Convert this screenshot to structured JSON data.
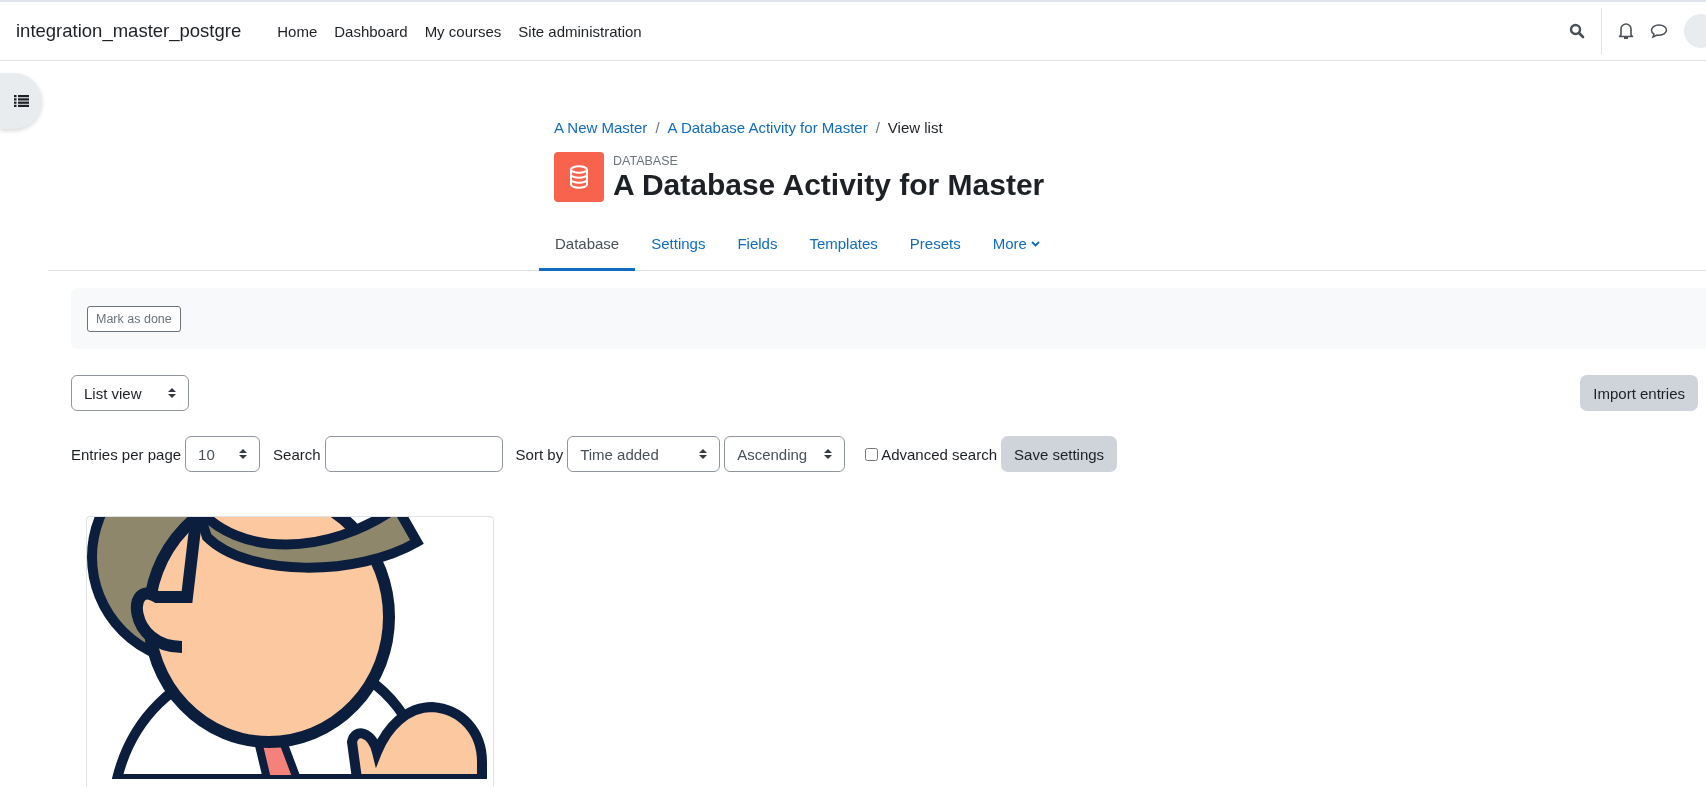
{
  "navbar": {
    "site_name": "integration_master_postgre",
    "menu": [
      {
        "label": "Home"
      },
      {
        "label": "Dashboard"
      },
      {
        "label": "My courses"
      },
      {
        "label": "Site administration"
      }
    ]
  },
  "breadcrumb_separator": "/",
  "breadcrumb": [
    {
      "label": "A New Master",
      "link": true
    },
    {
      "label": "A Database Activity for Master",
      "link": true
    },
    {
      "label": "View list",
      "link": false
    }
  ],
  "header": {
    "module": "DATABASE",
    "title": "A Database Activity for Master"
  },
  "tabs": [
    {
      "label": "Database",
      "selected": true,
      "dropdown": false
    },
    {
      "label": "Settings",
      "selected": false,
      "dropdown": false
    },
    {
      "label": "Fields",
      "selected": false,
      "dropdown": false
    },
    {
      "label": "Templates",
      "selected": false,
      "dropdown": false
    },
    {
      "label": "Presets",
      "selected": false,
      "dropdown": false
    },
    {
      "label": "More",
      "selected": false,
      "dropdown": true
    }
  ],
  "completion": {
    "button": "Mark as done"
  },
  "view_select": {
    "value": "List view"
  },
  "import_button": "Import entries",
  "filters": {
    "entries_label": "Entries per page",
    "entries_value": "10",
    "search_label": "Search",
    "sort_label": "Sort by",
    "sort_value": "Time added",
    "order_value": "Ascending",
    "advanced_label": "Advanced search",
    "advanced_checked": false,
    "save_button": "Save settings"
  }
}
